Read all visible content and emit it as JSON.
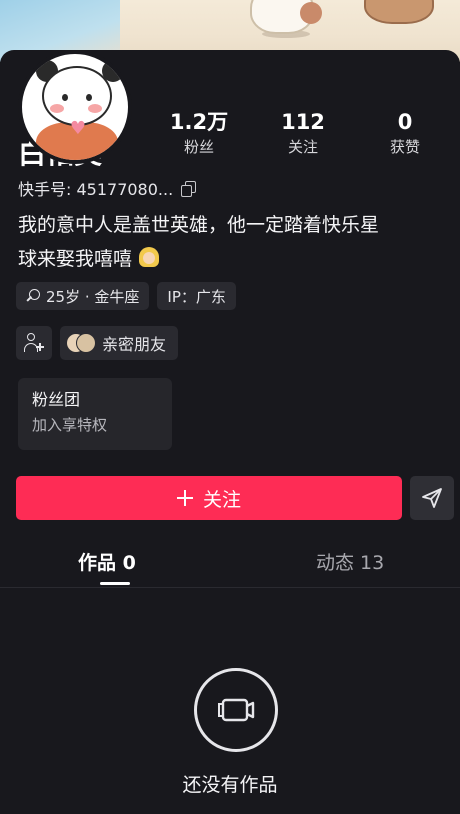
{
  "profile": {
    "name": "白佑美",
    "id_label": "快手号: 45177080...",
    "bio_line1": "我的意中人是盖世英雄，他一定踏着快乐星",
    "bio_line2": "球来娶我嘻嘻",
    "bio_emoji": "blonde-woman-emoji"
  },
  "stats": [
    {
      "value": "1.2万",
      "label": "粉丝"
    },
    {
      "value": "112",
      "label": "关注"
    },
    {
      "value": "0",
      "label": "获赞"
    }
  ],
  "tags": {
    "age_zodiac": "25岁 · 金牛座",
    "ip": "IP：广东"
  },
  "friends": {
    "close_friends_label": "亲密朋友"
  },
  "fan_club": {
    "title": "粉丝团",
    "subtitle": "加入享特权"
  },
  "actions": {
    "follow_label": "关注"
  },
  "tabs": [
    {
      "label": "作品 0",
      "active": true
    },
    {
      "label": "动态 13",
      "active": false
    }
  ],
  "empty_state": {
    "text": "还没有作品"
  },
  "colors": {
    "background": "#18181d",
    "follow_button": "#fe2c55",
    "chip": "#2a2a30"
  },
  "icons": [
    "copy-icon",
    "gender-female-icon",
    "person-plus-icon",
    "plus-icon",
    "send-icon",
    "camera-icon"
  ]
}
